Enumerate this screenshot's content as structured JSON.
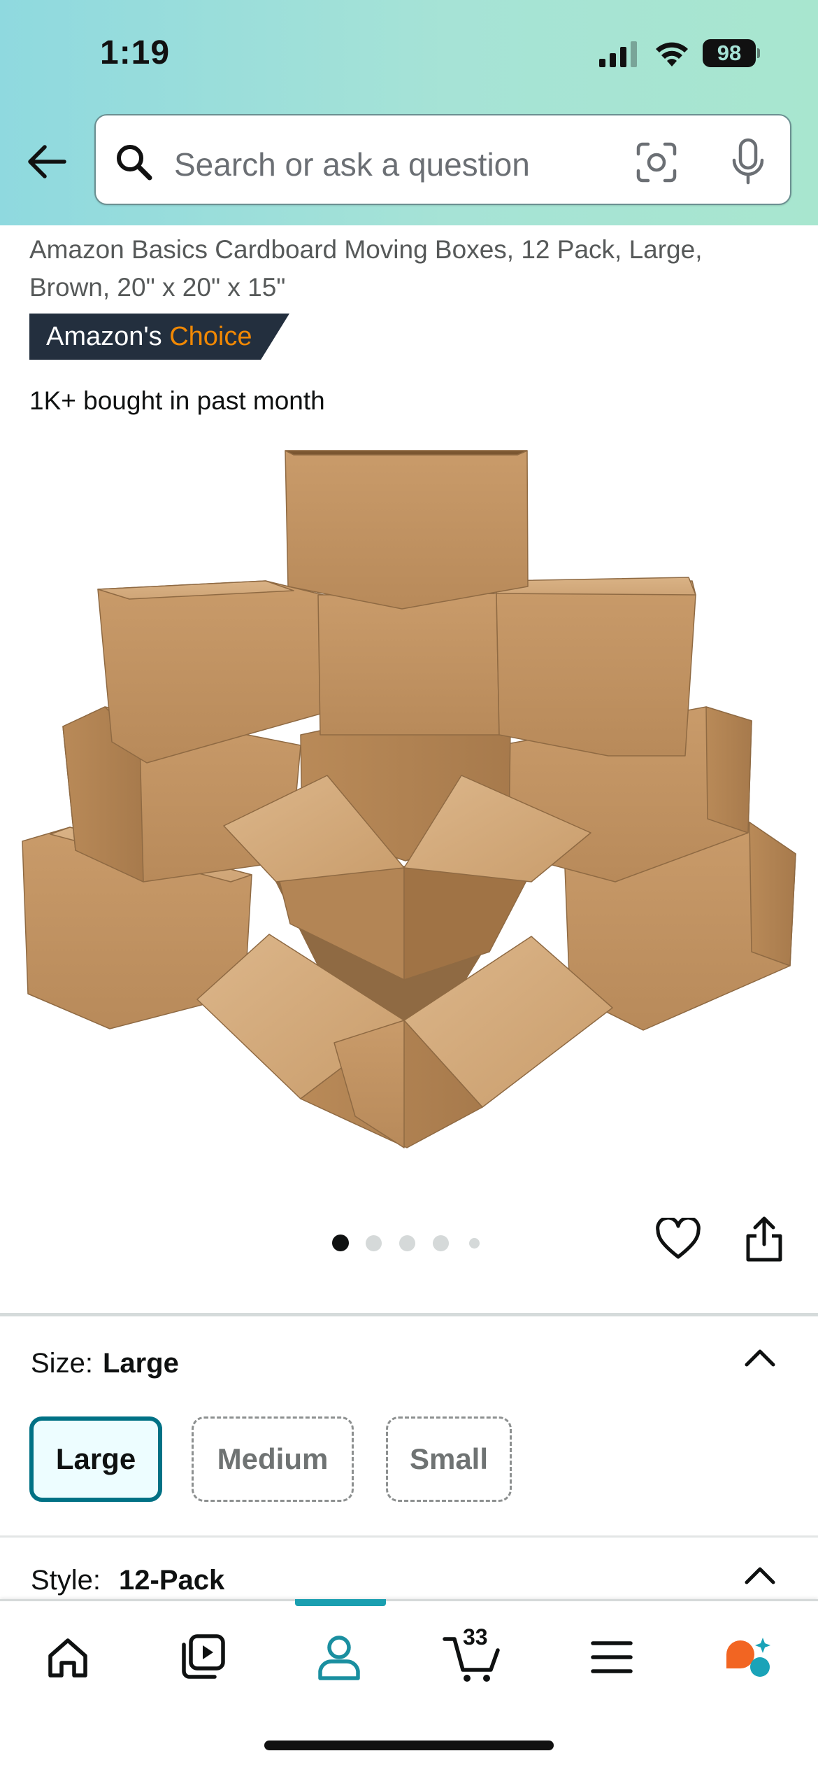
{
  "status_bar": {
    "time": "1:19",
    "battery": "98"
  },
  "header": {
    "search_placeholder": "Search or ask a question"
  },
  "product": {
    "title": "Amazon Basics Cardboard Moving Boxes, 12 Pack, Large, Brown, 20\" x 20\" x 15\"",
    "badge_prefix": "Amazon's",
    "badge_accent": "Choice",
    "bought_text": "1K+ bought in past month",
    "image_count": 5,
    "active_image_index": 0
  },
  "size": {
    "label": "Size:",
    "selected": "Large",
    "options": [
      "Large",
      "Medium",
      "Small"
    ]
  },
  "style": {
    "label": "Style:",
    "selected": "12-Pack"
  },
  "bottom_nav": {
    "cart_count": "33",
    "items": [
      "home-icon",
      "video-icon",
      "account-icon",
      "cart-icon",
      "menu-icon",
      "rufus-icon"
    ],
    "active": "account-icon"
  },
  "colors": {
    "accent_teal": "#007185",
    "badge_bg": "#232f3e",
    "badge_accent": "#f08804",
    "header_gradient_start": "#8fd9df",
    "header_gradient_end": "#a8e6cf"
  }
}
